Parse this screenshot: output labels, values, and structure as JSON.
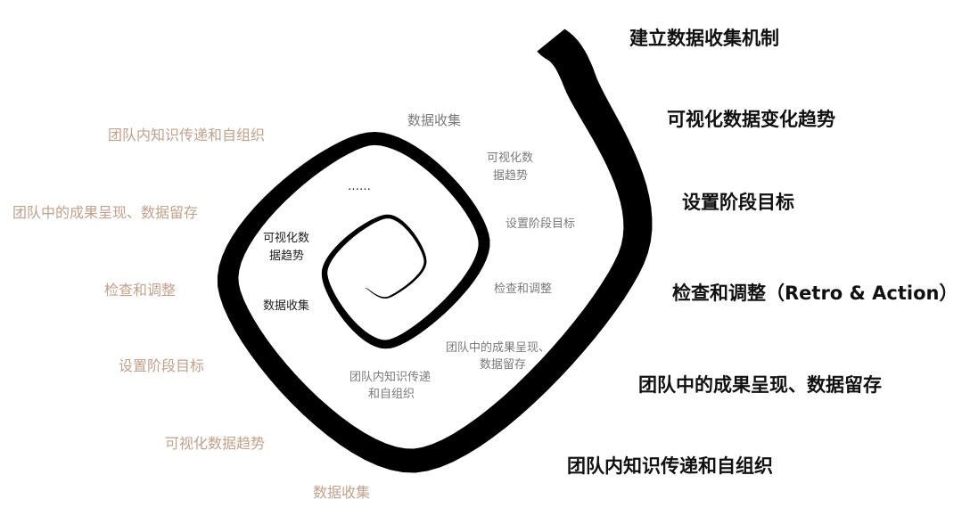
{
  "outer_labels": [
    "建立数据收集机制",
    "可视化数据变化趋势",
    "设置阶段目标",
    "检查和调整（Retro & Action）",
    "团队中的成果呈现、数据留存",
    "团队内知识传递和自组织"
  ],
  "left_labels": [
    "团队内知识传递和自组织",
    "团队中的成果呈现、数据留存",
    "检查和调整",
    "设置阶段目标",
    "可视化数据趋势",
    "数据收集"
  ],
  "middle_labels": {
    "collect": "数据收集",
    "visual_1": "可视化数",
    "visual_2": "据趋势",
    "goal": "设置阶段目标",
    "check": "检查和调整",
    "result_1": "团队中的成果呈现、",
    "result_2": "数据留存",
    "knowledge_1": "团队内知识传递",
    "knowledge_2": "和自组织"
  },
  "inner_labels": {
    "ellipsis": "……",
    "visual_1": "可视化数",
    "visual_2": "据趋势",
    "collect": "数据收集"
  },
  "colors": {
    "spiral": "#000000",
    "left_text": "#c3a08a",
    "middle_text": "#7a7a7a",
    "bold_text": "#111111"
  }
}
